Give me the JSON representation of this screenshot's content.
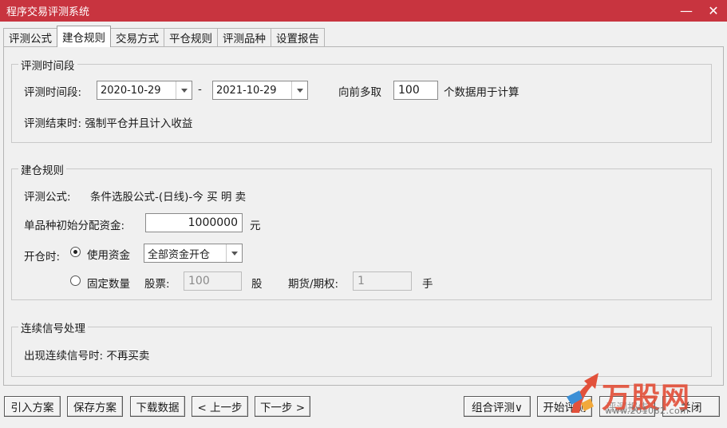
{
  "window": {
    "title": "程序交易评测系统",
    "minimize_glyph": "—",
    "close_glyph": "✕"
  },
  "tabs": [
    {
      "label": "评测公式"
    },
    {
      "label": "建仓规则",
      "active": true
    },
    {
      "label": "交易方式"
    },
    {
      "label": "平仓规则"
    },
    {
      "label": "评测品种"
    },
    {
      "label": "设置报告"
    }
  ],
  "time_period": {
    "legend": "评测时间段",
    "label": "评测时间段:",
    "start_date": "2020-10-29",
    "separator": "-",
    "end_date": "2021-10-29",
    "lookback_prefix": "向前多取",
    "lookback_value": "100",
    "lookback_suffix": "个数据用于计算",
    "end_rule": "评测结束时: 强制平仓并且计入收益"
  },
  "open_rules": {
    "legend": "建仓规则",
    "formula_label": "评测公式:",
    "formula_value": "条件选股公式-(日线)-今 买 明 卖",
    "capital_label": "单品种初始分配资金:",
    "capital_value": "1000000",
    "capital_unit": "元",
    "open_label": "开仓时:",
    "use_capital_label": "使用资金",
    "use_capital_mode": "全部资金开仓",
    "fixed_qty_label": "固定数量",
    "stock_label": "股票:",
    "stock_qty": "100",
    "stock_unit": "股",
    "futures_label": "期货/期权:",
    "futures_qty": "1",
    "futures_unit": "手",
    "selected_mode": "use_capital"
  },
  "signal": {
    "legend": "连续信号处理",
    "text": "出现连续信号时: 不再买卖"
  },
  "buttons": {
    "import": "引入方案",
    "save": "保存方案",
    "download": "下载数据",
    "prev": "< 上一步",
    "next": "下一步 >",
    "combo_eval": "组合评测∨",
    "start_eval": "开始评测",
    "report": "评测报告",
    "close": "关闭"
  },
  "watermark": {
    "brand": "万股网",
    "url": "www.201082.com"
  },
  "colors": {
    "titlebar": "#c8343f",
    "watermark": "#e2513b"
  }
}
